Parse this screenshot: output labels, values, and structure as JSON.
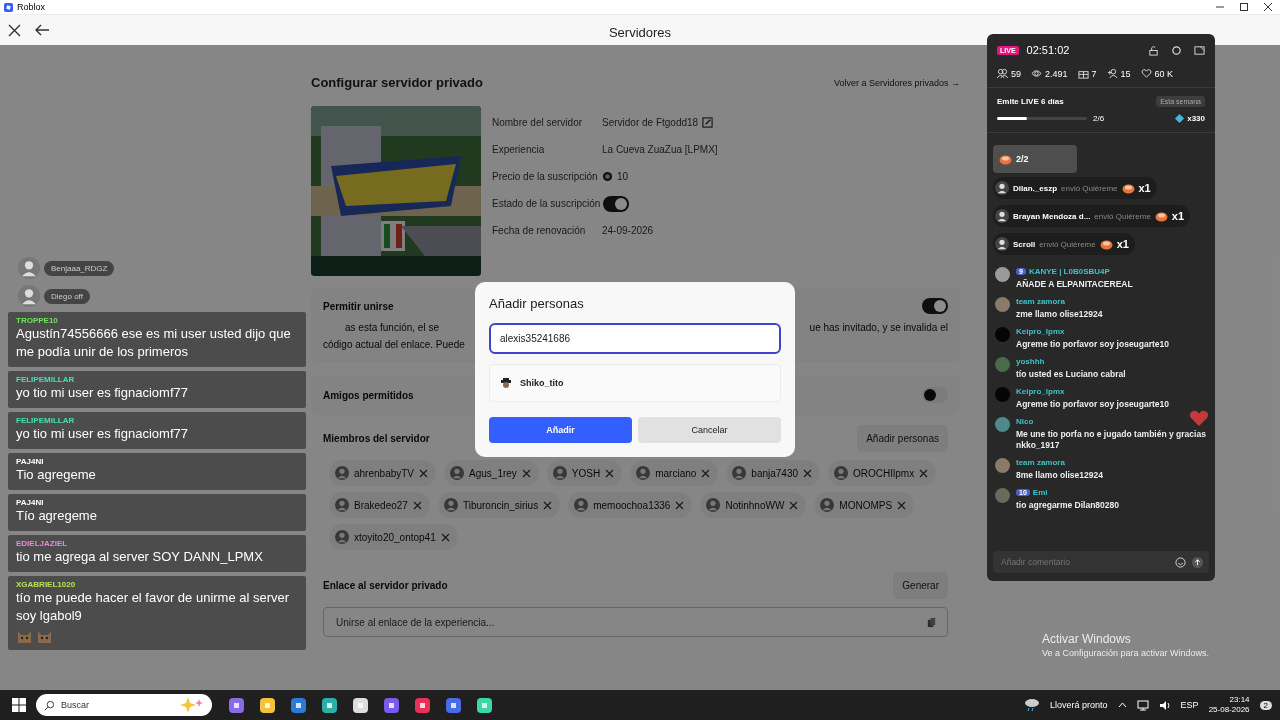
{
  "window": {
    "title": "Roblox"
  },
  "header": {
    "title": "Servidores"
  },
  "page": {
    "title": "Configurar servidor privado",
    "back_link": "Volver a Servidores privados →",
    "details": [
      {
        "kind": "editable",
        "label": "Nombre del servidor",
        "value": "Servidor de Ftgodd18"
      },
      {
        "kind": "text",
        "label": "Experiencia",
        "value": "La Cueva ZuaZua [LPMX]"
      },
      {
        "kind": "price",
        "label": "Precio de la suscripción",
        "value": "10"
      },
      {
        "kind": "toggle",
        "label": "Estado de la suscripción",
        "on": true
      },
      {
        "kind": "text",
        "label": "Fecha de renovación",
        "value": "24-09-2026"
      }
    ],
    "allow_join": {
      "label": "Permitir unirse",
      "on": true,
      "description_left": "as esta función, el se",
      "description_right": "ue has invitado, y se invalida el",
      "description_line2": "código actual del enlace. Puede"
    },
    "friends_allowed": {
      "label": "Amigos permitidos",
      "on": false
    },
    "members": {
      "label": "Miembros del servidor",
      "add_button": "Añadir personas",
      "items": [
        "ahrenbabyTV",
        "Agus_1rey",
        "YOSH",
        "marciano",
        "banja7430",
        "OROCHIlpmx",
        "Brakedeo27",
        "Tiburoncin_sirius",
        "memoochoa1336",
        "NotinhnoWW",
        "MONOMPS",
        "xtoyito20_ontop41"
      ]
    },
    "link": {
      "label": "Enlace al servidor privado",
      "generate_button": "Generar",
      "placeholder": "Unirse al enlace de la experiencia..."
    }
  },
  "dialog": {
    "title": "Añadir personas",
    "value": "alexis35241686",
    "suggestion": "Shiko_tito",
    "confirm": "Añadir",
    "cancel": "Cancelar"
  },
  "voice_chat": [
    {
      "name": "Benjaaa_RDGZ"
    },
    {
      "name": "Diego off"
    }
  ],
  "overlay_chat": [
    {
      "user": "TROPPE10",
      "color": "#6fe35a",
      "message": "Agustín74556666 ese es mi user usted dijo que me podía unir de los primeros"
    },
    {
      "user": "FELIPEMILLAR",
      "color": "#44e0b4",
      "message": "yo tio mi user es fignaciomf77"
    },
    {
      "user": "FELIPEMILLAR",
      "color": "#44e0b4",
      "message": "yo tio mi user es fignaciomf77"
    },
    {
      "user": "PAJ4NI",
      "color": "#ffffff",
      "message": "Tio agregeme"
    },
    {
      "user": "PAJ4NI",
      "color": "#ffffff",
      "message": "Tío agregeme"
    },
    {
      "user": "EDIELJAZIEL",
      "color": "#e58ad8",
      "message": "tio me agrega al server SOY DANN_LPMX"
    },
    {
      "user": "XGABRIEL1020",
      "color": "#b9e34e",
      "message": "tío me puede hacer el favor de unirme al server soy lgabol9",
      "stickers": [
        {
          "kind": "cat"
        },
        {
          "kind": "cat"
        }
      ]
    }
  ],
  "live_panel": {
    "badge": "LIVE",
    "time": "02:51:02",
    "stats": [
      {
        "kind": "people",
        "value": "59"
      },
      {
        "kind": "eye",
        "value": "2.491"
      },
      {
        "kind": "gift",
        "value": "7"
      },
      {
        "kind": "follow",
        "value": "15"
      },
      {
        "kind": "heart",
        "value": "60 K"
      }
    ],
    "goal": {
      "title": "Emite LIVE 6 días",
      "period": "Esta semana",
      "level": 0.33,
      "progress": "2/6",
      "reward": "x330"
    },
    "gift_summary": "2/2",
    "gifts": [
      {
        "user": "Dilan._eszp",
        "action": "envió Quiéreme",
        "count": "x1"
      },
      {
        "user": "Brayan Mendoza d...",
        "action": "envió Quiéreme",
        "count": "x1"
      },
      {
        "user": "Scroll",
        "action": "envió Quiéreme",
        "count": "x1"
      }
    ],
    "comments": [
      {
        "user": "KANYE | L0B0SBU4P",
        "badge": "9",
        "text": "AÑADE A ELPANITACEREAL",
        "color": "#9a9a9a"
      },
      {
        "user": "team zamora",
        "text": "zme llamo olise12924",
        "color": "#8a7a6a"
      },
      {
        "user": "Keipro_lpmx",
        "text": "Agreme tio porfavor soy joseugarte10",
        "color": "#050505"
      },
      {
        "user": "yoshhh",
        "text": "tío usted es Luciano cabral",
        "color": "#4a6a4a"
      },
      {
        "user": "Keipro_lpmx",
        "text": "Agreme tio porfavor soy joseugarte10",
        "color": "#050505"
      },
      {
        "user": "Nico",
        "text": "Me une tio porfa no e jugado también y gracias nkko_1917",
        "color": "#4e8a8a"
      },
      {
        "user": "team zamora",
        "text": "8me llamo olise12924",
        "color": "#8a7a6a"
      },
      {
        "user": "Emi",
        "badge": "10",
        "text": "tio agregarme Dilan80280",
        "color": "#6a6a5a"
      }
    ],
    "comment_placeholder": "Añadir comentario"
  },
  "activation_notice": {
    "title": "Activar Windows",
    "text": "Ve a Configuración para activar Windows."
  },
  "taskbar": {
    "search": "Buscar",
    "weather": "Lloverá pronto",
    "language": "ESP",
    "time": "23:14",
    "date": "25-08-2026",
    "notifications": "2"
  }
}
